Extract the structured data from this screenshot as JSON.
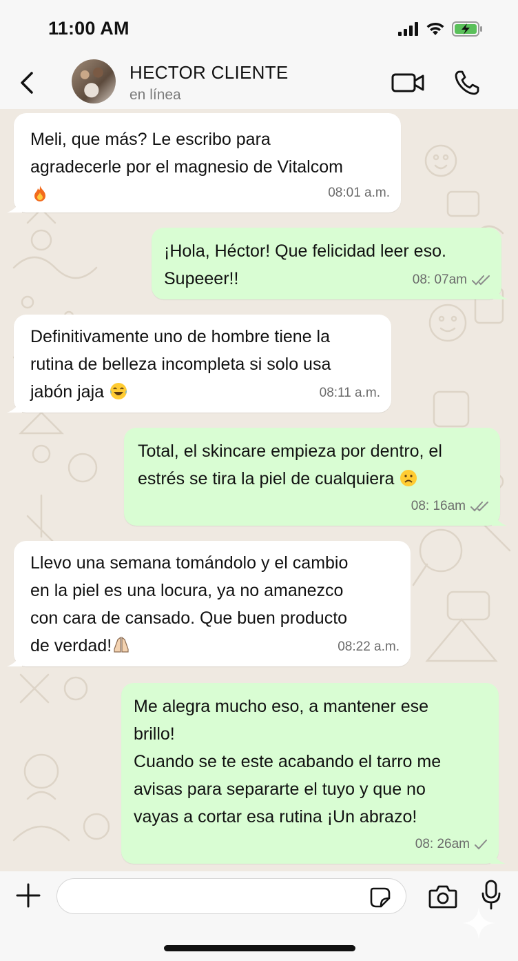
{
  "status_bar": {
    "time": "11:00 AM"
  },
  "header": {
    "contact_name": "HECTOR CLIENTE",
    "contact_status": "en línea"
  },
  "messages": [
    {
      "direction": "in",
      "text": "Meli, que más? Le escribo para\nagradecerle por el magnesio de Vitalcom",
      "emoji": "fire-emoji",
      "time": "08:01 a.m."
    },
    {
      "direction": "out",
      "text": "¡Hola, Héctor! Que felicidad leer eso.\nSupeeer!!",
      "time": "08: 07am",
      "status": "read"
    },
    {
      "direction": "in",
      "text": "Definitivamente uno de hombre tiene la\nrutina de belleza incompleta si solo usa\njabón jaja",
      "emoji": "laughing-tears-emoji",
      "time": "08:11 a.m."
    },
    {
      "direction": "out",
      "text": "Total, el skincare empieza por dentro, el\nestrés se tira la piel de cualquiera",
      "emoji": "frowning-face-emoji",
      "time": "08: 16am",
      "status": "read"
    },
    {
      "direction": "in",
      "text": "Llevo una semana tomándolo y el cambio\nen la piel es una locura, ya no amanezco\ncon cara de cansado. Que buen producto\nde verdad!",
      "emoji": "folded-hands-emoji",
      "time": "08:22 a.m."
    },
    {
      "direction": "out",
      "text": "Me alegra mucho eso, a mantener ese\nbrillo!\nCuando se te este acabando el tarro me\navisas para separarte el tuyo y que no\nvayas a cortar esa rutina ¡Un abrazo!",
      "time": "08: 26am",
      "status": "sent"
    }
  ],
  "composer": {
    "value": "",
    "placeholder": ""
  },
  "colors": {
    "incoming_bubble": "#ffffff",
    "outgoing_bubble": "#d9fdd3",
    "chat_background": "#efe9e1",
    "read_ticks": "#8a8a8a"
  },
  "icons": [
    "back-chevron-icon",
    "video-call-icon",
    "phone-icon",
    "plus-icon",
    "sticker-icon",
    "camera-icon",
    "microphone-icon",
    "signal-icon",
    "wifi-icon",
    "battery-charging-icon"
  ]
}
